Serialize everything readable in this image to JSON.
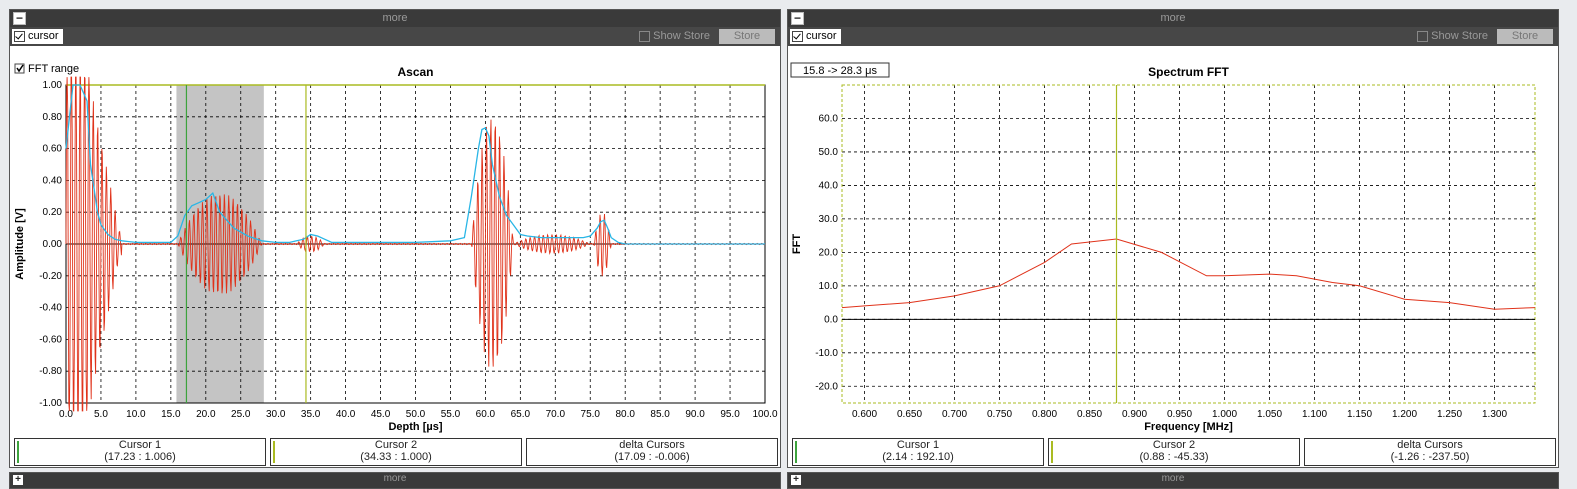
{
  "panels": [
    {
      "title": "more",
      "cursor_label": "cursor",
      "show_store_label": "Show Store",
      "store_label": "Store",
      "fft_range_label": "FFT range",
      "chart_title": "Ascan",
      "cursor1": {
        "title": "Cursor 1",
        "value": "(17.23 : 1.006)"
      },
      "cursor2": {
        "title": "Cursor 2",
        "value": "(34.33 : 1.000)"
      },
      "delta": {
        "title": "delta Cursors",
        "value": "(17.09 : -0.006)"
      }
    },
    {
      "title": "more",
      "cursor_label": "cursor",
      "show_store_label": "Show Store",
      "store_label": "Store",
      "range_label": "15.8 -> 28.3 μs",
      "chart_title": "Spectrum FFT",
      "cursor1": {
        "title": "Cursor 1",
        "value": "(2.14 : 192.10)"
      },
      "cursor2": {
        "title": "Cursor 2",
        "value": "(0.88 : -45.33)"
      },
      "delta": {
        "title": "delta Cursors",
        "value": "(-1.26 : -237.50)"
      }
    }
  ],
  "bottom": [
    "more",
    "more"
  ],
  "colors": {
    "signal": "#e0321a",
    "envelope": "#29b6e6",
    "cursor_green": "#3da33d",
    "cursor_olive": "#aabb22",
    "fft_band": "#c4c4c4"
  },
  "chart_data": [
    {
      "type": "line",
      "title": "Ascan",
      "xlabel": "Depth [µs]",
      "ylabel": "Amplitude [V]",
      "xlim": [
        0,
        100
      ],
      "ylim": [
        -1.0,
        1.0
      ],
      "xticks": [
        "0.0",
        "5.0",
        "10.0",
        "15.0",
        "20.0",
        "25.0",
        "30.0",
        "35.0",
        "40.0",
        "45.0",
        "50.0",
        "55.0",
        "60.0",
        "65.0",
        "70.0",
        "75.0",
        "80.0",
        "85.0",
        "90.0",
        "95.0",
        "100.0"
      ],
      "yticks": [
        "-1.00",
        "-0.80",
        "-0.60",
        "-0.40",
        "-0.20",
        "0.00",
        "0.20",
        "0.40",
        "0.60",
        "0.80",
        "1.00"
      ],
      "fft_range": [
        15.8,
        28.3
      ],
      "cursors": [
        17.23,
        34.33
      ],
      "envelope_series": {
        "name": "envelope",
        "x": [
          0,
          1,
          2,
          3,
          3.5,
          4,
          4.5,
          5,
          6,
          7,
          8,
          10,
          12,
          15,
          16,
          17,
          18,
          19,
          20,
          21,
          22,
          23,
          24,
          26,
          28,
          30,
          32,
          33,
          34,
          35,
          36,
          37,
          38,
          40,
          45,
          50,
          55,
          57,
          58,
          59,
          59.5,
          60,
          60.5,
          61,
          62,
          63,
          64,
          65,
          66,
          68,
          70,
          72,
          74,
          75,
          76,
          76.5,
          77,
          77.5,
          78,
          79,
          80,
          85,
          90,
          100
        ],
        "y": [
          0.6,
          1.0,
          1.0,
          0.9,
          0.5,
          0.35,
          0.2,
          0.12,
          0.06,
          0.03,
          0.02,
          0.01,
          0.01,
          0.01,
          0.05,
          0.18,
          0.24,
          0.26,
          0.28,
          0.32,
          0.2,
          0.15,
          0.1,
          0.05,
          0.02,
          0.01,
          0.01,
          0.02,
          0.03,
          0.06,
          0.05,
          0.03,
          0.01,
          0.01,
          0.01,
          0.01,
          0.02,
          0.04,
          0.3,
          0.6,
          0.72,
          0.73,
          0.68,
          0.5,
          0.3,
          0.18,
          0.12,
          0.06,
          0.05,
          0.04,
          0.04,
          0.04,
          0.04,
          0.05,
          0.1,
          0.14,
          0.15,
          0.1,
          0.04,
          0.01,
          0,
          0,
          0,
          0
        ]
      },
      "signal_series": {
        "name": "signal",
        "bursts": [
          {
            "x": [
              0,
              8
            ],
            "amp": 1.0
          },
          {
            "x": [
              16,
              28
            ],
            "amp": 0.32
          },
          {
            "x": [
              33,
              37
            ],
            "amp": 0.05
          },
          {
            "x": [
              58,
              64
            ],
            "amp": 0.8
          },
          {
            "x": [
              64,
              75
            ],
            "amp": 0.06
          },
          {
            "x": [
              75.5,
              78
            ],
            "amp": 0.2
          }
        ]
      }
    },
    {
      "type": "line",
      "title": "Spectrum FFT",
      "xlabel": "Frequency [MHz]",
      "ylabel": "FFT",
      "xlim": [
        0.575,
        1.345
      ],
      "ylim": [
        -25,
        70
      ],
      "xticks": [
        "0.600",
        "0.650",
        "0.700",
        "0.750",
        "0.800",
        "0.850",
        "0.900",
        "0.950",
        "1.000",
        "1.050",
        "1.100",
        "1.150",
        "1.200",
        "1.250",
        "1.300"
      ],
      "yticks": [
        "-20.0",
        "-10.0",
        "0.0",
        "10.0",
        "20.0",
        "30.0",
        "40.0",
        "50.0",
        "60.0"
      ],
      "cursor": 0.88,
      "series": [
        {
          "x": [
            0.575,
            0.6,
            0.65,
            0.7,
            0.75,
            0.8,
            0.83,
            0.88,
            0.93,
            0.98,
            1.0,
            1.05,
            1.08,
            1.12,
            1.15,
            1.2,
            1.25,
            1.3,
            1.345
          ],
          "y": [
            3.5,
            4.0,
            5.0,
            7.0,
            10.0,
            17.0,
            22.5,
            24.0,
            20.0,
            13.0,
            13.0,
            13.5,
            13.0,
            11.0,
            10.0,
            6.0,
            5.0,
            3.0,
            3.5
          ]
        }
      ]
    }
  ]
}
